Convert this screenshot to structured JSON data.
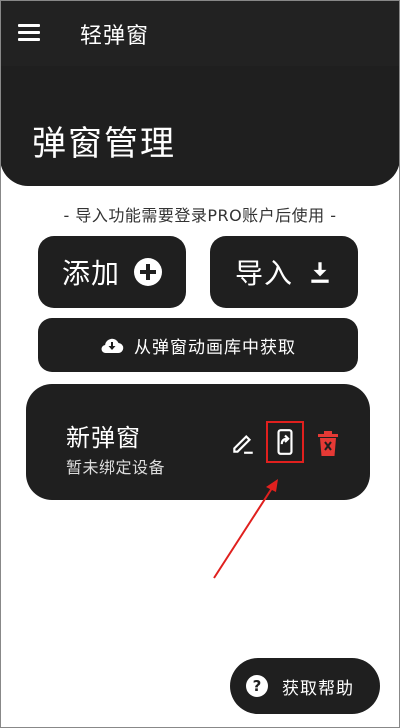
{
  "app": {
    "title": "轻弹窗"
  },
  "header": {
    "page_title": "弹窗管理"
  },
  "notice": "- 导入功能需要登录PRO账户后使用 -",
  "actions": {
    "add_label": "添加",
    "import_label": "导入",
    "gallery_label": "从弹窗动画库中获取"
  },
  "popup_card": {
    "title": "新弹窗",
    "subtitle": "暂未绑定设备"
  },
  "help": {
    "label": "获取帮助"
  },
  "colors": {
    "dark": "#1f1f1f",
    "delete": "#e53935",
    "highlight": "#e0201e"
  },
  "icons": [
    "menu-icon",
    "add-icon",
    "download-icon",
    "cloud-download-icon",
    "edit-icon",
    "bind-device-icon",
    "delete-icon",
    "help-icon"
  ]
}
